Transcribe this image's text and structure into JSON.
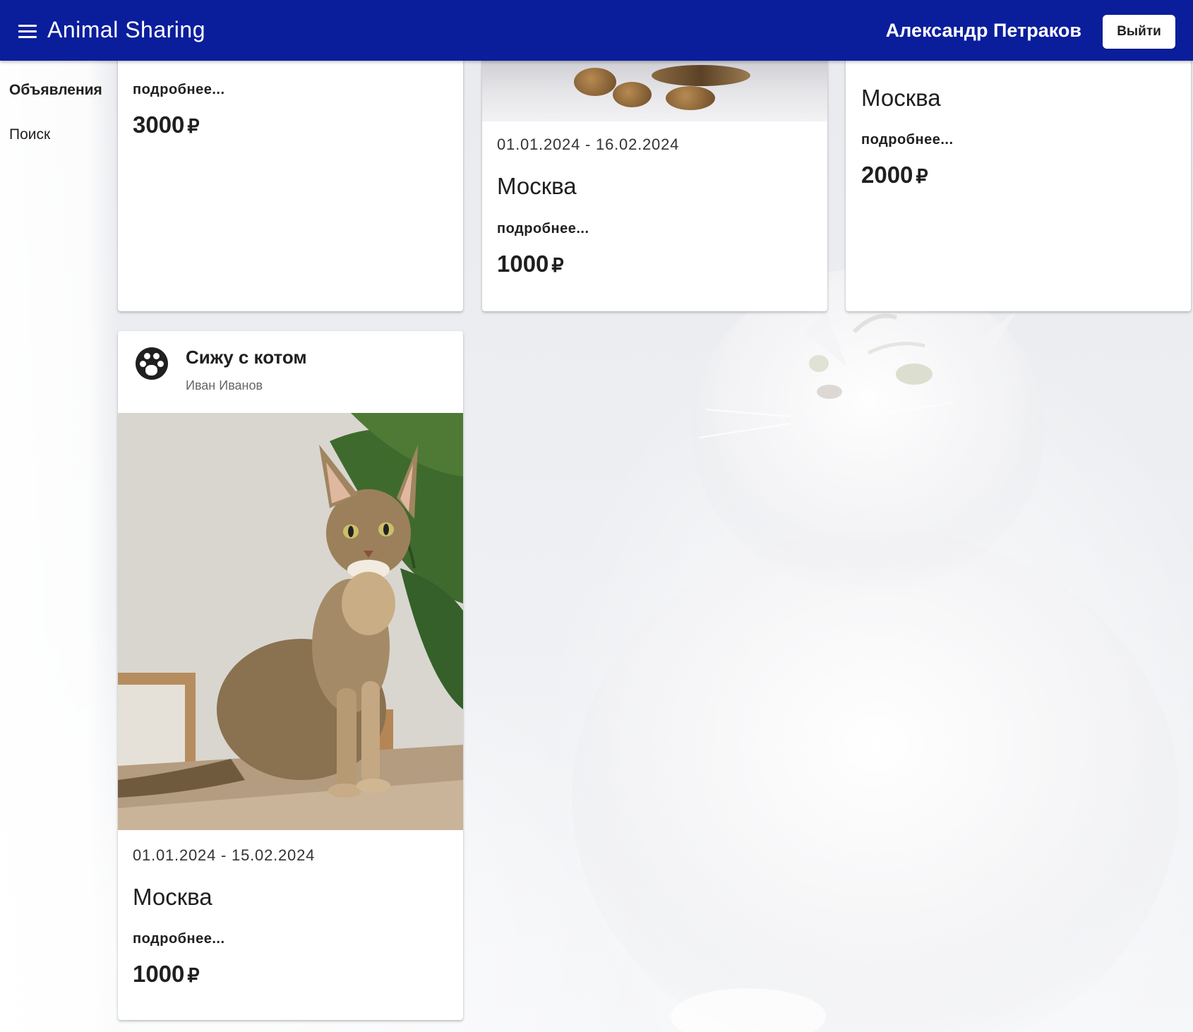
{
  "app": {
    "title": "Animal Sharing",
    "user_name": "Александр Петраков",
    "logout_label": "Выйти"
  },
  "sidebar": {
    "items": [
      {
        "label": "Объявления",
        "active": true
      },
      {
        "label": "Поиск",
        "active": false
      }
    ]
  },
  "cards": [
    {
      "city": "",
      "more_label": "подробнее...",
      "price": "3000",
      "currency": "₽"
    },
    {
      "dates": "01.01.2024 - 16.02.2024",
      "city": "Москва",
      "more_label": "подробнее...",
      "price": "1000",
      "currency": "₽"
    },
    {
      "city": "Москва",
      "more_label": "подробнее...",
      "price": "2000",
      "currency": "₽"
    },
    {
      "title": "Сижу с котом",
      "author": "Иван Иванов",
      "dates": "01.01.2024 - 15.02.2024",
      "city": "Москва",
      "more_label": "подробнее...",
      "price": "1000",
      "currency": "₽"
    }
  ],
  "colors": {
    "appbar": "#0a1e9c",
    "background": "#eeeff2"
  },
  "icons": {
    "menu": "menu-icon",
    "avatar": "pets-avatar-icon",
    "logout": "logout-button"
  }
}
